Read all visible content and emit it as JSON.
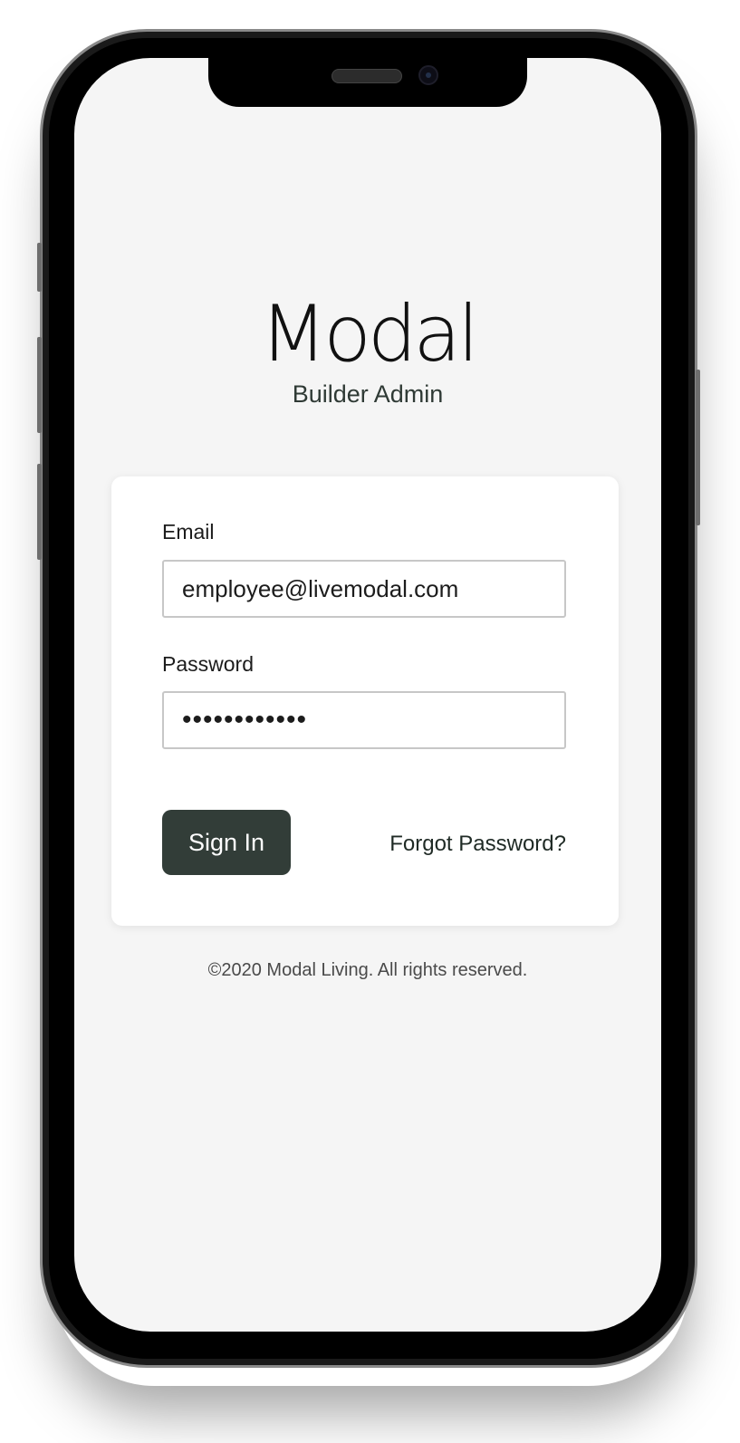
{
  "brand": {
    "logo_text": "Modal",
    "subtitle": "Builder Admin"
  },
  "form": {
    "email_label": "Email",
    "email_value": "employee@livemodal.com",
    "password_label": "Password",
    "password_value": "••••••••••••",
    "sign_in_label": "Sign In",
    "forgot_label": "Forgot Password?"
  },
  "footer": {
    "copyright": "©2020 Modal Living. All rights reserved."
  },
  "colors": {
    "screen_background": "#f5f5f5",
    "card_background": "#ffffff",
    "button_background": "#323d38",
    "button_text": "#ffffff"
  }
}
